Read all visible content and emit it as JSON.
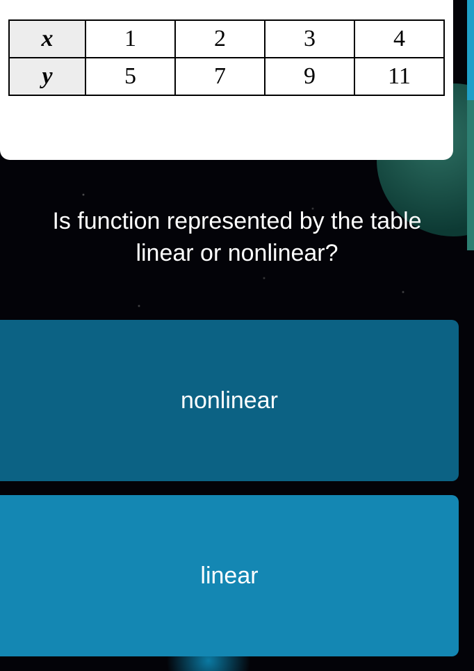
{
  "chart_data": {
    "type": "table",
    "rows": [
      {
        "label": "x",
        "values": [
          1,
          2,
          3,
          4
        ]
      },
      {
        "label": "y",
        "values": [
          5,
          7,
          9,
          11
        ]
      }
    ]
  },
  "question": {
    "line1": "Is function represented by the table",
    "line2": "linear or nonlinear?"
  },
  "answers": {
    "option1": "nonlinear",
    "option2": "linear"
  }
}
